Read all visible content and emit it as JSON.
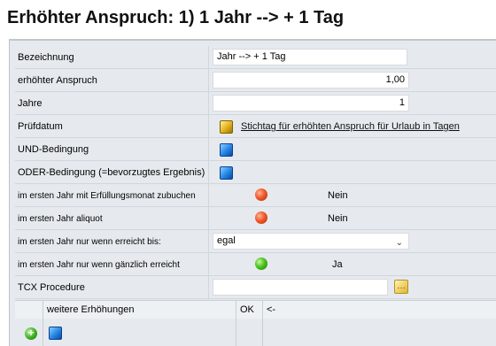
{
  "title": "Erhöhter Anspruch: 1) 1 Jahr --> + 1 Tag",
  "rows": {
    "bezeichnung": {
      "label": "Bezeichnung",
      "value": "Jahr --> + 1 Tag"
    },
    "anspruch": {
      "label": "erhöhter Anspruch",
      "value": "1,00"
    },
    "jahre": {
      "label": "Jahre",
      "value": "1"
    },
    "pruefdatum": {
      "label": "Prüfdatum",
      "link": "Stichtag für erhöhten Anspruch für Urlaub in Tagen"
    },
    "und": {
      "label": "UND-Bedingung"
    },
    "oder": {
      "label": "ODER-Bedingung (=bevorzugtes Ergebnis)"
    },
    "zubuchen": {
      "label": "im ersten Jahr mit Erfüllungsmonat zubuchen",
      "status": "Nein",
      "color": "#f05a2a"
    },
    "aliquot": {
      "label": "im ersten Jahr aliquot",
      "status": "Nein",
      "color": "#f05a2a"
    },
    "erreicht": {
      "label": "im ersten Jahr nur wenn erreicht bis:",
      "value": "egal"
    },
    "gaenzlich": {
      "label": "im ersten Jahr nur wenn gänzlich erreicht",
      "status": "Ja",
      "color": "#4cc21f"
    },
    "tcx": {
      "label": "TCX Procedure",
      "value": ""
    }
  },
  "grid": {
    "headers": [
      "weitere Erhöhungen",
      "OK",
      "<-"
    ]
  },
  "icons": {
    "cube_gold": "gold-cube-icon",
    "cube_blue": "blue-cube-icon",
    "orb_red": "red-orb-icon",
    "orb_green": "green-orb-icon",
    "add": "add-icon",
    "procedure": "procedure-browse-icon"
  }
}
